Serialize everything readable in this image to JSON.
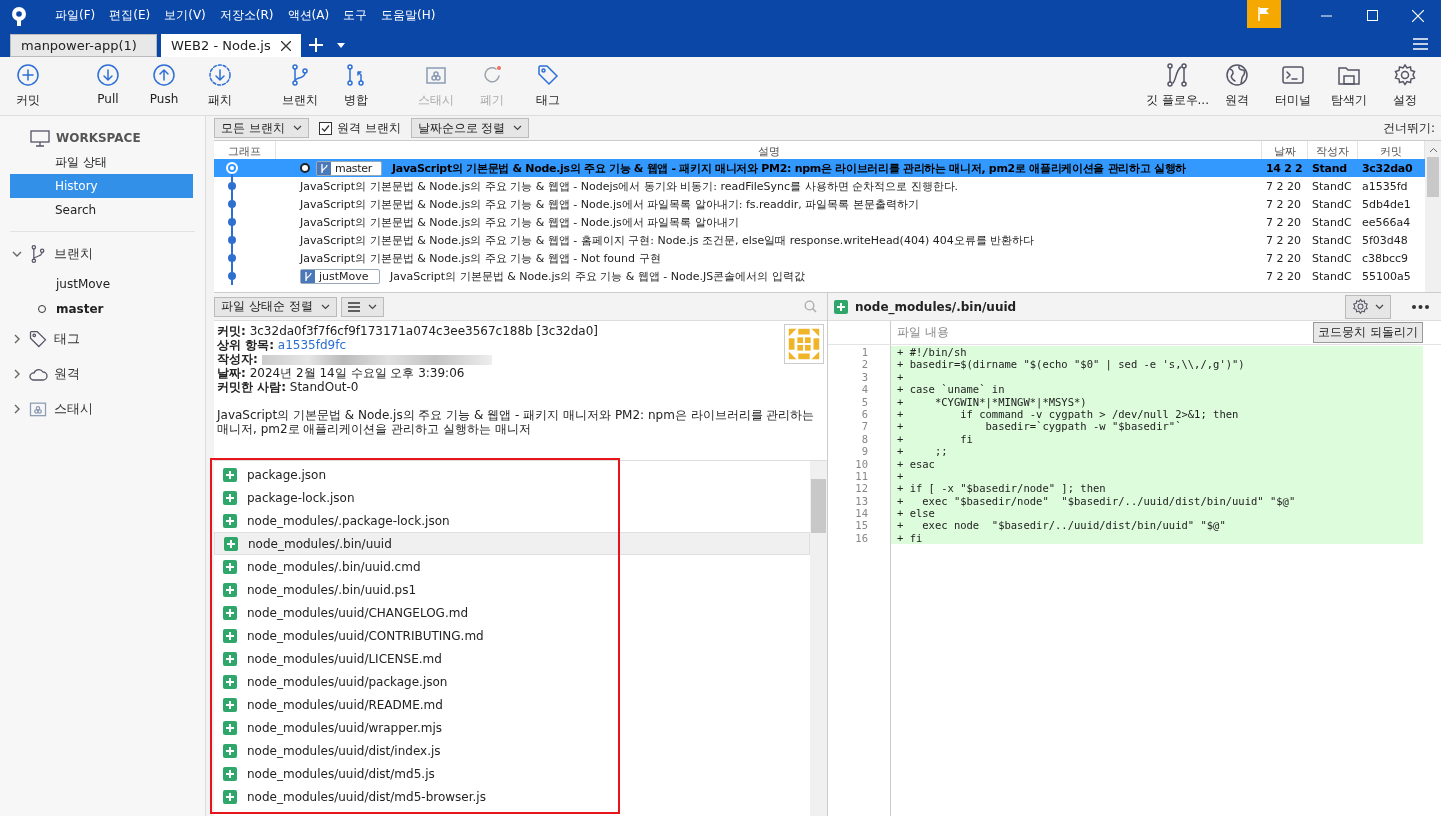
{
  "menu": [
    "파일(F)",
    "편집(E)",
    "보기(V)",
    "저장소(R)",
    "액션(A)",
    "도구",
    "도움말(H)"
  ],
  "tabs": [
    {
      "label": "manpower-app(1)",
      "selected": false
    },
    {
      "label": "WEB2 - Node.js",
      "selected": true
    }
  ],
  "toolbar": {
    "groups": [
      [
        {
          "kind": "commit",
          "label": "커밋",
          "disabled": false
        }
      ],
      [
        {
          "kind": "pull",
          "label": "Pull",
          "disabled": false
        },
        {
          "kind": "push",
          "label": "Push",
          "disabled": false
        },
        {
          "kind": "patch",
          "label": "패치",
          "disabled": false
        }
      ],
      [
        {
          "kind": "branch",
          "label": "브랜치",
          "disabled": false
        },
        {
          "kind": "merge",
          "label": "병합",
          "disabled": false
        }
      ],
      [
        {
          "kind": "stash",
          "label": "스태시",
          "disabled": true
        },
        {
          "kind": "discard",
          "label": "폐기",
          "disabled": true
        },
        {
          "kind": "tag",
          "label": "태그",
          "disabled": false
        }
      ]
    ],
    "right": [
      {
        "kind": "gitflow",
        "label": "깃 플로우...",
        "disabled": false
      },
      {
        "kind": "remote",
        "label": "원격",
        "disabled": false
      },
      {
        "kind": "terminal",
        "label": "터미널",
        "disabled": false
      },
      {
        "kind": "explorer",
        "label": "탐색기",
        "disabled": false
      },
      {
        "kind": "settings",
        "label": "설정",
        "disabled": false
      }
    ]
  },
  "sidebar": {
    "workspace": {
      "label": "WORKSPACE",
      "items": [
        {
          "label": "파일 상태",
          "selected": false
        },
        {
          "label": "History",
          "selected": true
        },
        {
          "label": "Search",
          "selected": false
        }
      ]
    },
    "sections": [
      {
        "kind": "branch",
        "label": "브랜치",
        "expanded": true,
        "children": [
          {
            "label": "justMove",
            "current": false
          },
          {
            "label": "master",
            "current": true
          }
        ]
      },
      {
        "kind": "tag",
        "label": "태그",
        "expanded": false
      },
      {
        "kind": "remote",
        "label": "원격",
        "expanded": false
      },
      {
        "kind": "stash",
        "label": "스태시",
        "expanded": false
      }
    ]
  },
  "filters": {
    "branches": "모든 브랜치",
    "remote_branches": {
      "label": "원격 브랜치",
      "checked": true
    },
    "sort": "날짜순으로 정렬",
    "jump": "건너뛰기:"
  },
  "log": {
    "columns": [
      "그래프",
      "설명",
      "날짜",
      "작성자",
      "커밋"
    ],
    "rows": [
      {
        "selected": true,
        "head": true,
        "branch": "master",
        "description": "JavaScript의 기본문법 & Node.js의 주요 기능 & 웹앱 - 패키지 매니저와 PM2: npm은 라이브러리를 관리하는 매니저, pm2로 애플리케이션을 관리하고 실행하",
        "date": "14 2 2",
        "author": "Stand",
        "commit": "3c32da0"
      },
      {
        "selected": false,
        "head": false,
        "description": "JavaScript의 기본문법 & Node.js의 주요 기능 & 웹앱 - Nodejs에서 동기와 비동기: readFileSync를 사용하면 순차적으로 진행한다.",
        "date": "7 2 20",
        "author": "StandC",
        "commit": "a1535fd"
      },
      {
        "selected": false,
        "head": false,
        "description": "JavaScript의 기본문법 & Node.js의 주요 기능 & 웹앱 - Node.js에서 파일목록 알아내기: fs.readdir, 파일목록 본문출력하기",
        "date": "7 2 20",
        "author": "StandC",
        "commit": "5db4de1"
      },
      {
        "selected": false,
        "head": false,
        "description": "JavaScript의 기본문법 & Node.js의 주요 기능 & 웹앱 - Node.js에서 파일목록 알아내기",
        "date": "7 2 20",
        "author": "StandC",
        "commit": "ee566a4"
      },
      {
        "selected": false,
        "head": false,
        "description": "JavaScript의 기본문법 & Node.js의 주요 기능 & 웹앱 - 홈페이지 구현: Node.js 조건문, else일때 response.writeHead(404) 404오류를 반환하다",
        "date": "7 2 20",
        "author": "StandC",
        "commit": "5f03d48"
      },
      {
        "selected": false,
        "head": false,
        "description": "JavaScript의 기본문법 & Node.js의 주요 기능 & 웹앱 - Not found 구현",
        "date": "7 2 20",
        "author": "StandC",
        "commit": "c38bcc9"
      },
      {
        "selected": false,
        "head": false,
        "branch": "justMove",
        "description": "JavaScript의 기본문법 & Node.js의 주요 기능 & 웹앱 - Node.JS콘솔에서의 입력값",
        "date": "7 2 20",
        "author": "StandC",
        "commit": "55100a5"
      }
    ]
  },
  "details": {
    "sort": "파일 상태순 정렬",
    "fields": [
      {
        "kind": "text",
        "label": "커밋:",
        "value": "3c32da0f3f7f6cf9f173171a074c3ee3567c188b [3c32da0]"
      },
      {
        "kind": "link",
        "label": "상위 항목:",
        "value": "a1535fd9fc"
      },
      {
        "kind": "redacted",
        "label": "작성자:"
      },
      {
        "kind": "text",
        "label": "날짜:",
        "value": "2024년 2월 14일 수요일 오후 3:39:06"
      },
      {
        "kind": "text",
        "label": "커밋한 사람:",
        "value": "StandOut-0"
      }
    ],
    "message": "JavaScript의 기본문법 & Node.js의 주요 기능 & 웹앱 - 패키지 매니저와 PM2: npm은 라이브러리를 관리하는 매니저, pm2로 애플리케이션을 관리하고 실행하는 매니저"
  },
  "files": {
    "highlight_frame": true,
    "items": [
      {
        "path": "package.json",
        "kind": "added",
        "selected": false
      },
      {
        "path": "package-lock.json",
        "kind": "added",
        "selected": false
      },
      {
        "path": "node_modules/.package-lock.json",
        "kind": "added",
        "selected": false
      },
      {
        "path": "node_modules/.bin/uuid",
        "kind": "added",
        "selected": true
      },
      {
        "path": "node_modules/.bin/uuid.cmd",
        "kind": "added",
        "selected": false
      },
      {
        "path": "node_modules/.bin/uuid.ps1",
        "kind": "added",
        "selected": false
      },
      {
        "path": "node_modules/uuid/CHANGELOG.md",
        "kind": "added",
        "selected": false
      },
      {
        "path": "node_modules/uuid/CONTRIBUTING.md",
        "kind": "added",
        "selected": false
      },
      {
        "path": "node_modules/uuid/LICENSE.md",
        "kind": "added",
        "selected": false
      },
      {
        "path": "node_modules/uuid/package.json",
        "kind": "added",
        "selected": false
      },
      {
        "path": "node_modules/uuid/README.md",
        "kind": "added",
        "selected": false
      },
      {
        "path": "node_modules/uuid/wrapper.mjs",
        "kind": "added",
        "selected": false
      },
      {
        "path": "node_modules/uuid/dist/index.js",
        "kind": "added",
        "selected": false
      },
      {
        "path": "node_modules/uuid/dist/md5.js",
        "kind": "added",
        "selected": false
      },
      {
        "path": "node_modules/uuid/dist/md5-browser.js",
        "kind": "added",
        "selected": false
      }
    ]
  },
  "diff": {
    "file": "node_modules/.bin/uuid",
    "kind": "added",
    "content_label": "파일 내용",
    "revert_button": "코드뭉치 되돌리기",
    "lines": [
      {
        "no": "1",
        "kind": "added",
        "text": "+ #!/bin/sh"
      },
      {
        "no": "2",
        "kind": "added",
        "text": "+ basedir=$(dirname \"$(echo \"$0\" | sed -e 's,\\\\,/,g')\")"
      },
      {
        "no": "3",
        "kind": "added",
        "text": "+"
      },
      {
        "no": "4",
        "kind": "added",
        "text": "+ case `uname` in"
      },
      {
        "no": "5",
        "kind": "added",
        "text": "+     *CYGWIN*|*MINGW*|*MSYS*)"
      },
      {
        "no": "6",
        "kind": "added",
        "text": "+         if command -v cygpath > /dev/null 2>&1; then"
      },
      {
        "no": "7",
        "kind": "added",
        "text": "+             basedir=`cygpath -w \"$basedir\"`"
      },
      {
        "no": "8",
        "kind": "added",
        "text": "+         fi"
      },
      {
        "no": "9",
        "kind": "added",
        "text": "+     ;;"
      },
      {
        "no": "10",
        "kind": "added",
        "text": "+ esac"
      },
      {
        "no": "11",
        "kind": "added",
        "text": "+"
      },
      {
        "no": "12",
        "kind": "added",
        "text": "+ if [ -x \"$basedir/node\" ]; then"
      },
      {
        "no": "13",
        "kind": "added",
        "text": "+   exec \"$basedir/node\"  \"$basedir/../uuid/dist/bin/uuid\" \"$@\""
      },
      {
        "no": "14",
        "kind": "added",
        "text": "+ else"
      },
      {
        "no": "15",
        "kind": "added",
        "text": "+   exec node  \"$basedir/../uuid/dist/bin/uuid\" \"$@\""
      },
      {
        "no": "16",
        "kind": "added",
        "text": "+ fi"
      }
    ]
  }
}
